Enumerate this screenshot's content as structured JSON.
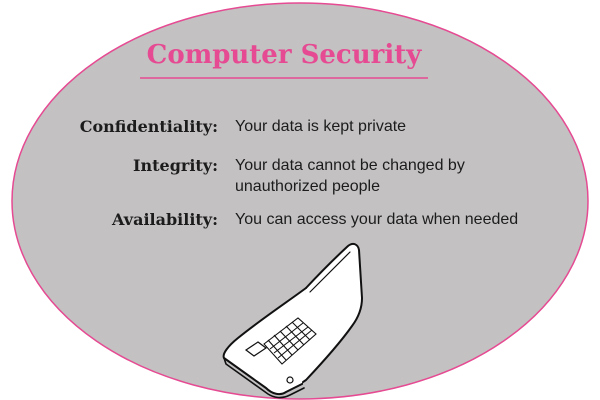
{
  "title": "Computer Security",
  "terms": [
    {
      "term": "Confidentiality:",
      "definition": "Your data is kept private"
    },
    {
      "term": "Integrity:",
      "definition": "Your data cannot be changed by unauthorized people"
    },
    {
      "term": "Availability:",
      "definition": "You can access your data when needed"
    }
  ],
  "colors": {
    "ellipse_fill": "#c3c1c1",
    "ellipse_border": "#e54a92",
    "title": "#e54a92",
    "underline": "#e54a92",
    "text": "#1c1c1c"
  },
  "illustration": {
    "icon": "laptop-icon"
  }
}
